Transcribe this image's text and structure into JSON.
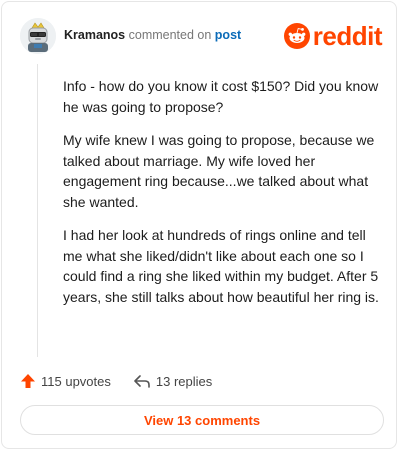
{
  "comment": {
    "username": "Kramanos",
    "action_text": "commented on",
    "post_link": "post",
    "paragraphs": [
      "Info - how do you know it cost $150? Did you know he was going to propose?",
      "My wife knew I was going to propose, because we talked about marriage. My wife loved her engagement ring because...we talked about what she wanted.",
      "I had her look at hundreds of rings online and tell me what she liked/didn't like about each one so I could find a ring she liked within my budget. After 5 years, she still talks about how beautiful her ring is."
    ]
  },
  "brand": {
    "wordmark": "reddit",
    "color": "#ff4500",
    "icon": "reddit-alien-icon"
  },
  "stats": {
    "upvotes": "115 upvotes",
    "replies": "13 replies",
    "upvote_icon": "upvote-arrow-icon",
    "reply_icon": "reply-arrow-icon"
  },
  "footer": {
    "view_comments": "View 13 comments"
  },
  "colors": {
    "accent": "#ff4500",
    "link": "#0b6bb8",
    "muted": "#777777"
  }
}
